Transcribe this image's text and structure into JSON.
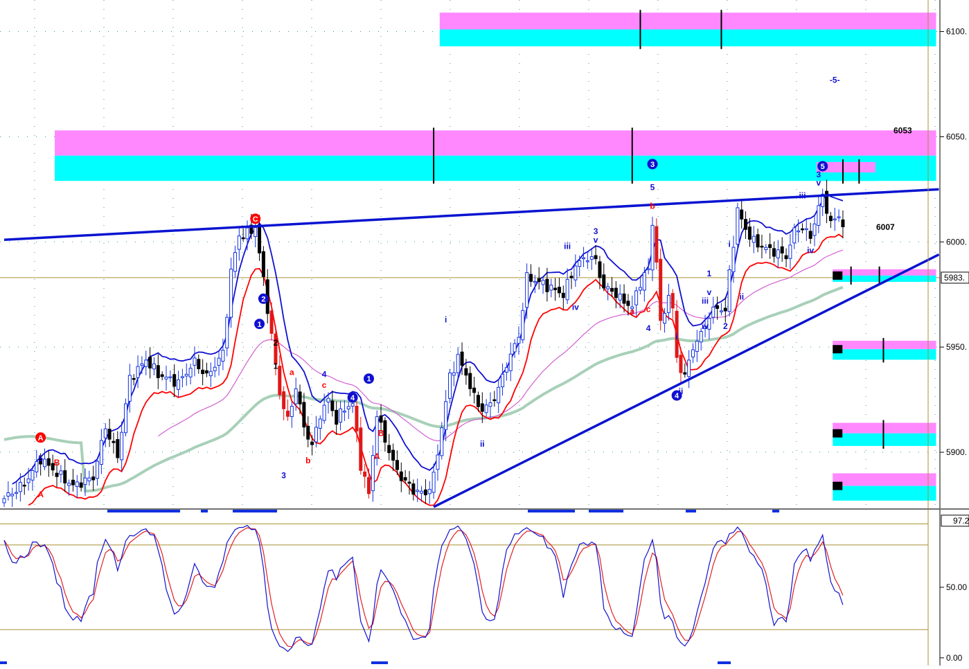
{
  "chart_data": [
    {
      "type": "candlestick",
      "price_axis": {
        "ticks": [
          {
            "value": 6100,
            "label": "6100."
          },
          {
            "value": 6050,
            "label": "6050."
          },
          {
            "value": 6000,
            "label": "6000."
          },
          {
            "value": 5950,
            "label": "5950."
          },
          {
            "value": 5900,
            "label": "5900."
          }
        ],
        "range": [
          5874,
          6115
        ],
        "current_price_label": "5983.",
        "current_price": 5983
      },
      "price_annotations": [
        {
          "value": 6053,
          "label": "6053",
          "color": "#000000"
        },
        {
          "value": 6007,
          "label": "6007",
          "color": "#000000"
        }
      ],
      "wave_labels": [
        {
          "text": "C",
          "circled": true,
          "color": "#ff0000",
          "i": 62,
          "price": 6011
        },
        {
          "text": "A",
          "circled": true,
          "color": "#ff0000",
          "i": 9,
          "price": 5907
        },
        {
          "text": "2",
          "circled": true,
          "color": "#1010d0",
          "i": 64,
          "price": 5973
        },
        {
          "text": "1",
          "circled": true,
          "color": "#1010d0",
          "i": 63,
          "price": 5961
        },
        {
          "text": "1",
          "circled": true,
          "color": "#1010d0",
          "i": 90,
          "price": 5935
        },
        {
          "text": "4",
          "circled": true,
          "color": "#1010d0",
          "i": 86,
          "price": 5926
        },
        {
          "text": "3",
          "circled": true,
          "color": "#1010d0",
          "i": 160,
          "price": 6037
        },
        {
          "text": "4",
          "circled": true,
          "color": "#1010d0",
          "i": 166,
          "price": 5927
        },
        {
          "text": "5",
          "circled": true,
          "color": "#1010d0",
          "i": 202,
          "price": 6036
        },
        {
          "text": "5",
          "circled": false,
          "color": "#1010d0",
          "i": 9,
          "price": 5897
        },
        {
          "text": "B",
          "circled": false,
          "color": "#ff0000",
          "i": 13,
          "price": 5895
        },
        {
          "text": "A",
          "circled": false,
          "color": "#ff0000",
          "i": 9,
          "price": 5880
        },
        {
          "text": "2",
          "circled": false,
          "color": "#000000",
          "i": 67,
          "price": 5952
        },
        {
          "text": "1",
          "circled": false,
          "color": "#000000",
          "i": 67,
          "price": 5941
        },
        {
          "text": "a",
          "circled": false,
          "color": "#ff0000",
          "i": 71,
          "price": 5938
        },
        {
          "text": "4",
          "circled": false,
          "color": "#1010d0",
          "i": 79,
          "price": 5937
        },
        {
          "text": "c",
          "circled": false,
          "color": "#ff0000",
          "i": 79,
          "price": 5932
        },
        {
          "text": "3",
          "circled": false,
          "color": "#1010d0",
          "i": 69,
          "price": 5889
        },
        {
          "text": "b",
          "circled": false,
          "color": "#ff0000",
          "i": 75,
          "price": 5896
        },
        {
          "text": "B",
          "circled": false,
          "color": "#ff0000",
          "i": 93,
          "price": 5909
        },
        {
          "text": "A",
          "circled": false,
          "color": "#ff0000",
          "i": 92,
          "price": 5898
        },
        {
          "text": "i",
          "circled": false,
          "color": "#1010d0",
          "i": 109,
          "price": 5963
        },
        {
          "text": "ii",
          "circled": false,
          "color": "#1010d0",
          "i": 118,
          "price": 5904
        },
        {
          "text": "3",
          "circled": false,
          "color": "#1010d0",
          "i": 146,
          "price": 6005
        },
        {
          "text": "v",
          "circled": false,
          "color": "#1010d0",
          "i": 146,
          "price": 6001
        },
        {
          "text": "iii",
          "circled": false,
          "color": "#1010d0",
          "i": 139,
          "price": 5998
        },
        {
          "text": "iv",
          "circled": false,
          "color": "#1010d0",
          "i": 141,
          "price": 5969
        },
        {
          "text": "a",
          "circled": false,
          "color": "#ff0000",
          "i": 155,
          "price": 5967
        },
        {
          "text": "5",
          "circled": false,
          "color": "#1010d0",
          "i": 160,
          "price": 6026
        },
        {
          "text": "b",
          "circled": false,
          "color": "#ff0000",
          "i": 160,
          "price": 6017
        },
        {
          "text": "c",
          "circled": false,
          "color": "#ff0000",
          "i": 159,
          "price": 5968
        },
        {
          "text": "4",
          "circled": false,
          "color": "#1010d0",
          "i": 159,
          "price": 5959
        },
        {
          "text": "i",
          "circled": false,
          "color": "#1010d0",
          "i": 166,
          "price": 5955
        },
        {
          "text": "ii",
          "circled": false,
          "color": "#1010d0",
          "i": 167,
          "price": 5929
        },
        {
          "text": "1",
          "circled": false,
          "color": "#1010d0",
          "i": 174,
          "price": 5985
        },
        {
          "text": "v",
          "circled": false,
          "color": "#1010d0",
          "i": 174,
          "price": 5976
        },
        {
          "text": "iii",
          "circled": false,
          "color": "#1010d0",
          "i": 173,
          "price": 5972
        },
        {
          "text": "iv",
          "circled": false,
          "color": "#1010d0",
          "i": 173,
          "price": 5960
        },
        {
          "text": "2",
          "circled": false,
          "color": "#1010d0",
          "i": 178,
          "price": 5960
        },
        {
          "text": "i",
          "circled": false,
          "color": "#1010d0",
          "i": 179,
          "price": 5999
        },
        {
          "text": "ii",
          "circled": false,
          "color": "#1010d0",
          "i": 182,
          "price": 5974
        },
        {
          "text": "iii",
          "circled": false,
          "color": "#1010d0",
          "i": 197,
          "price": 6022
        },
        {
          "text": "iv",
          "circled": false,
          "color": "#1010d0",
          "i": 199,
          "price": 5996
        },
        {
          "text": "3",
          "circled": false,
          "color": "#1010d0",
          "i": 201,
          "price": 6032
        },
        {
          "text": "v",
          "circled": false,
          "color": "#1010d0",
          "i": 201,
          "price": 6028
        },
        {
          "text": "-5-",
          "circled": false,
          "color": "#1010d0",
          "i": 205,
          "price": 6077
        }
      ],
      "zones": [
        {
          "x_from": 108,
          "x_to": 230,
          "top": 6109,
          "mid": 6101,
          "bottom": 6093,
          "ticks": [
            157,
            177
          ]
        },
        {
          "x_from": 13,
          "x_to": 230,
          "top": 6053,
          "mid": 6041,
          "bottom": 6029,
          "ticks": [
            106,
            155
          ]
        },
        {
          "x_from": 201,
          "x_to": 215,
          "top": 6038,
          "mid": 6033,
          "bottom": 6029,
          "ticks": [
            207,
            211
          ]
        },
        {
          "x_from": 205,
          "x_to": 230,
          "top": 5987,
          "mid": 5984,
          "bottom": 5981,
          "ticks": [
            209,
            216
          ]
        },
        {
          "x_from": 205,
          "x_to": 230,
          "top": 5953,
          "mid": 5949,
          "bottom": 5944,
          "ticks": [
            217
          ]
        },
        {
          "x_from": 205,
          "x_to": 230,
          "top": 5914,
          "mid": 5909,
          "bottom": 5903,
          "ticks": [
            217
          ]
        },
        {
          "x_from": 205,
          "x_to": 230,
          "top": 5890,
          "mid": 5884,
          "bottom": 5877,
          "ticks": []
        }
      ],
      "trendlines": [
        {
          "from": [
            0,
            6001
          ],
          "to": [
            230,
            6025
          ],
          "color": "#0a14d0"
        },
        {
          "from": [
            106,
            5874
          ],
          "to": [
            230,
            5994
          ],
          "color": "#0a14d0"
        }
      ],
      "moving_averages": [
        {
          "color": "#ff0000",
          "role": "lower band"
        },
        {
          "color": "#1010d0",
          "role": "upper band"
        },
        {
          "color": "#d060d0",
          "role": "medium average"
        },
        {
          "color": "#a8d0b8",
          "role": "slow average"
        }
      ]
    },
    {
      "type": "line",
      "y_axis": {
        "ticks": [
          {
            "value": 50,
            "label": "50.00"
          },
          {
            "value": 0,
            "label": "0.00"
          }
        ],
        "range": [
          -4,
          104
        ],
        "current_value_label": "97.2",
        "current_value": 97.2,
        "guides": [
          95,
          80,
          20
        ]
      },
      "series": [
        {
          "role": "fast",
          "color": "#1010d0"
        },
        {
          "role": "slow",
          "color": "#e02020"
        }
      ]
    }
  ]
}
